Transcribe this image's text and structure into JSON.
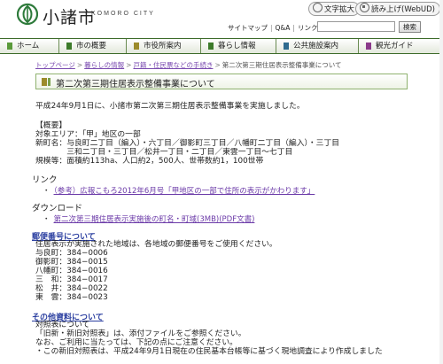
{
  "header": {
    "city_name": "小諸市",
    "city_roman": "KOMORO CITY",
    "font_size_btn": "文字拡大",
    "read_aloud_btn": "読み上げ(WebUD)",
    "top_links": [
      "サイトマップ",
      "Q&A",
      "リンク集"
    ],
    "search_placeholder": "",
    "search_btn": "検索"
  },
  "global_nav": [
    {
      "label": "ホーム",
      "color": "#5a9a3a"
    },
    {
      "label": "市の概要",
      "color": "#3c7a2a"
    },
    {
      "label": "市役所案内",
      "color": "#9c8b2b"
    },
    {
      "label": "暮らし情報",
      "color": "#3c7a2a"
    },
    {
      "label": "公共施設案内",
      "color": "#2f6b8f"
    },
    {
      "label": "観光ガイド",
      "color": "#8b3a8b"
    }
  ],
  "breadcrumb": [
    "トップページ",
    "暮らしの情報",
    "戸籍・住民票などの手続き",
    "第二次第三期住居表示整備事業について"
  ],
  "page_title": "第二次第三期住居表示整備事業について",
  "intro": "平成24年9月1日に、小諸市第二次第三期住居表示整備事業を実施しました。",
  "overview": {
    "heading": "【概要】",
    "lines": [
      "対象エリア：「甲」地区の一部",
      "新町名：与良町二丁目（編入）・六丁目／御影町三丁目／八幡町二丁目（編入）・三丁目",
      "　　　　三和二丁目・三丁目／松井一丁目・二丁目／東雲一丁目〜七丁目",
      "規模等：面積約113ha、人口約2，500人、世帯数約1，100世帯"
    ]
  },
  "links_section": {
    "heading": "リンク",
    "items": [
      "（参考）広報こもろ2012年6月号「甲地区の一部で住所の表示がかわります」"
    ]
  },
  "download_section": {
    "heading": "ダウンロード",
    "items": [
      "第二次第三期住居表示実施後の町名・町域(3MB)(PDF文書)"
    ]
  },
  "postal_section": {
    "heading": "郵便番号について",
    "lines": [
      "住居表示が実施された地域は、各地域の郵便番号をご使用ください。",
      "与良町：384−0006",
      "御影町：384−0015",
      "八幡町：384−0016",
      "三　和：384−0017",
      "松　井：384−0022",
      "東　雲：384−0023"
    ]
  },
  "other_section": {
    "heading": "その他資料について",
    "lines": [
      "対照表について",
      "「旧新・新旧対照表」は、添付ファイルをご参照ください。",
      "なお、ご利用に当たっては、下記の点にご注意ください。",
      "・この新旧対照表は、平成24年9月1日現在の住民基本台帳等に基づく現地調査により作成しました"
    ]
  }
}
